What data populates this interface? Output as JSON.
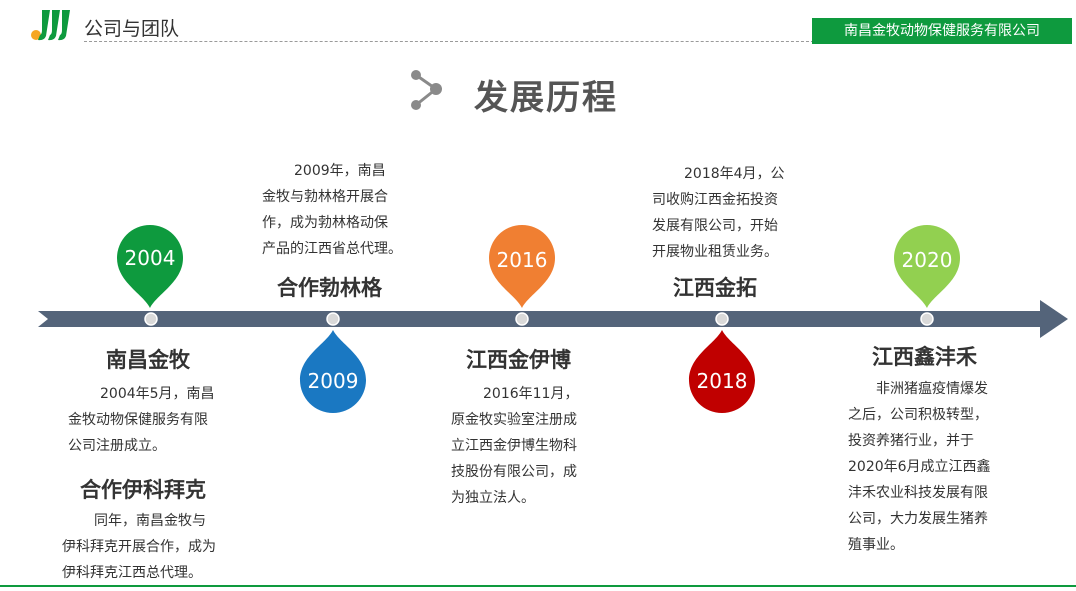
{
  "header": {
    "section_title": "公司与团队",
    "company_name": "南昌金牧动物保健服务有限公司",
    "main_title": "发展历程"
  },
  "colors": {
    "brand_green": "#0e9a3e",
    "axis": "#54647a",
    "drop_2004": "#0e9a3e",
    "drop_2009": "#1a78c2",
    "drop_2016": "#f07f32",
    "drop_2018": "#c00000",
    "drop_2020": "#92d050"
  },
  "events": [
    {
      "year": "2004",
      "heading": "南昌金牧",
      "lines": [
        "2004年5月，南昌",
        "金牧动物保健服务有限",
        "公司注册成立。"
      ]
    },
    {
      "year": "2004b",
      "heading": "合作伊科拜克",
      "lines": [
        "同年，南昌金牧与",
        "伊科拜克开展合作，成为",
        "伊科拜克江西总代理。"
      ]
    },
    {
      "year": "2009",
      "heading": "合作勃林格",
      "lines": [
        "2009年，南昌",
        "金牧与勃林格开展合",
        "作，成为勃林格动保",
        "产品的江西省总代理。"
      ]
    },
    {
      "year": "2016",
      "heading": "江西金伊博",
      "lines": [
        "2016年11月，",
        "原金牧实验室注册成",
        "立江西金伊博生物科",
        "技股份有限公司，成",
        "为独立法人。"
      ]
    },
    {
      "year": "2018",
      "heading": "江西金拓",
      "lines": [
        "2018年4月，公",
        "司收购江西金拓投资",
        "发展有限公司，开始",
        "开展物业租赁业务。"
      ]
    },
    {
      "year": "2020",
      "heading": "江西鑫沣禾",
      "lines": [
        "非洲猪瘟疫情爆发",
        "之后，公司积极转型，",
        "投资养猪行业，并于",
        "2020年6月成立江西鑫",
        "沣禾农业科技发展有限",
        "公司，大力发展生猪养",
        "殖事业。"
      ]
    }
  ],
  "years": {
    "y2004": "2004",
    "y2009": "2009",
    "y2016": "2016",
    "y2018": "2018",
    "y2020": "2020"
  }
}
